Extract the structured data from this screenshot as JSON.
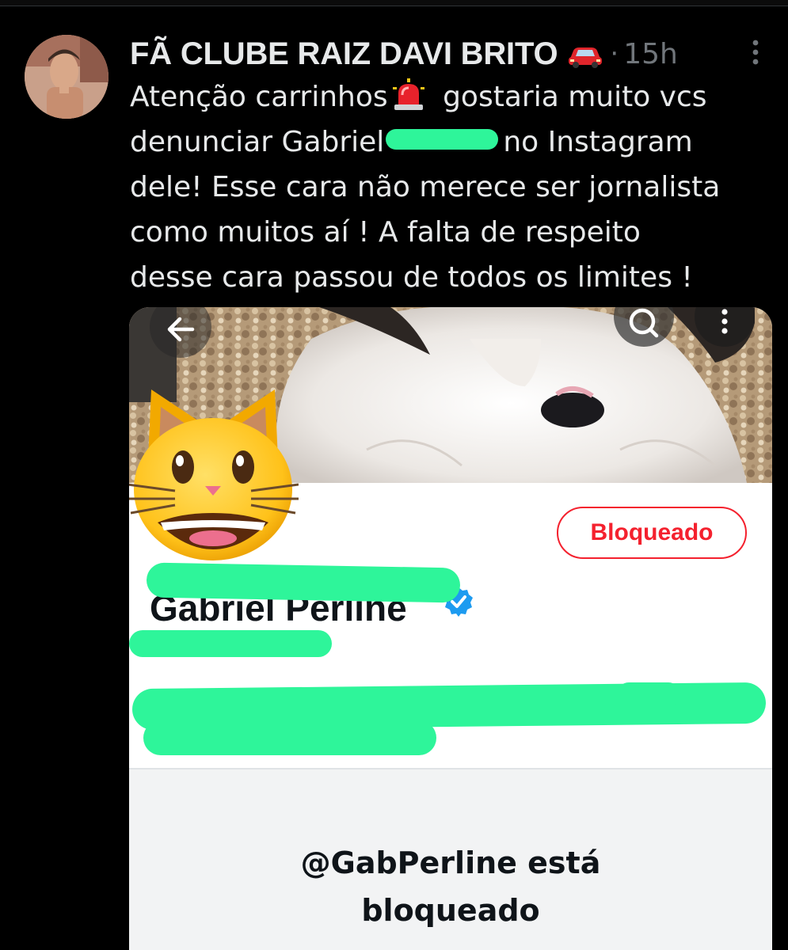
{
  "tweet": {
    "author_name": "FÃ CLUBE RAIZ DAVI BRITO",
    "author_emoji": "car-icon",
    "separator": "·",
    "timestamp": "15h",
    "text_lines": [
      {
        "before": "Atenção carrinhos",
        "after": " gostaria muito vcs"
      },
      {
        "before": "denunciar Gabriel",
        "after": "no Instagram"
      },
      "dele!  Esse cara não merece ser jornalista",
      "como muitos aí !  A falta de respeito",
      "desse cara passou de todos os limites !"
    ],
    "inline_icons": [
      "siren-icon"
    ]
  },
  "embedded_screenshot": {
    "header_icons": [
      "back-arrow-icon",
      "search-icon",
      "kebab-menu-icon"
    ],
    "blocked_button_label": "Bloqueado",
    "profile_name_partial": "Gabriel Perline",
    "verified_badge": "verified-icon",
    "blocked_message_line1": "@GabPerline está",
    "blocked_message_line2": "bloqueado",
    "overlay_emoji": "grinning-cat-icon"
  },
  "colors": {
    "background": "#000000",
    "text_primary": "#e7e9ea",
    "text_secondary": "#71767b",
    "blocked_red": "#f4212e",
    "redaction_green": "#2ef59a",
    "verified_blue": "#1d9bf0"
  }
}
